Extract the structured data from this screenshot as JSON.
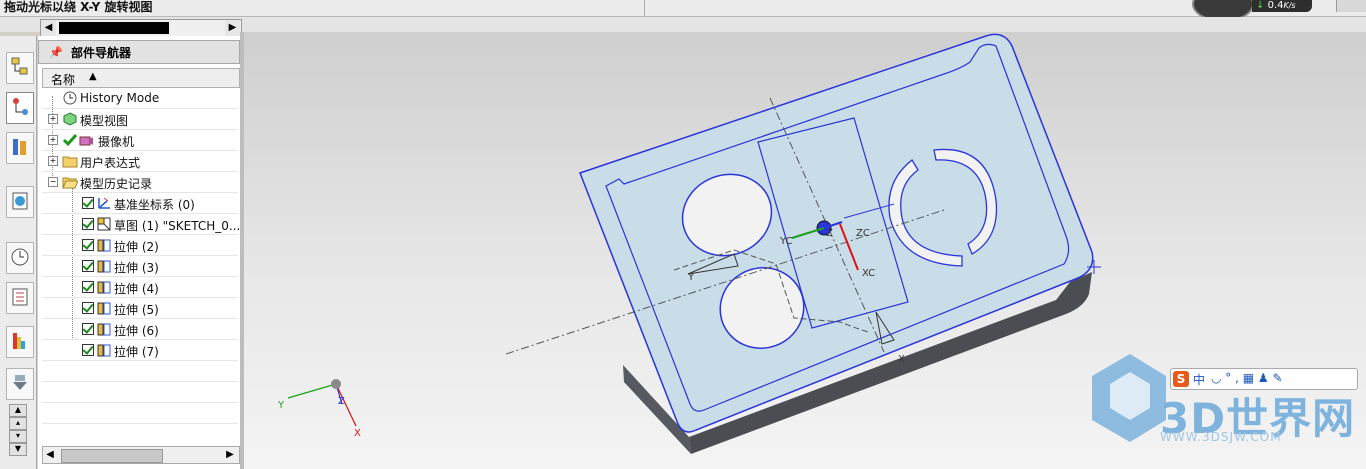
{
  "title_bar": {
    "hint_text": "拖动光标以绕 X-Y 旋转视图"
  },
  "net_speed": {
    "rate": "0.4",
    "unit": "K/s"
  },
  "navigator": {
    "title": "部件导航器",
    "column_header": "名称",
    "items": [
      {
        "label": "History Mode"
      },
      {
        "label": "模型视图"
      },
      {
        "label": "摄像机"
      },
      {
        "label": "用户表达式"
      },
      {
        "label": "模型历史记录"
      },
      {
        "label": "基准坐标系 (0)"
      },
      {
        "label": "草图 (1) \"SKETCH_0..."
      },
      {
        "label": "拉伸 (2)"
      },
      {
        "label": "拉伸 (3)"
      },
      {
        "label": "拉伸 (4)"
      },
      {
        "label": "拉伸 (5)"
      },
      {
        "label": "拉伸 (6)"
      },
      {
        "label": "拉伸 (7)"
      }
    ]
  },
  "viewport": {
    "axis_labels": {
      "x": "X",
      "y": "Y",
      "z": "Z",
      "xc": "XC",
      "yc": "YC",
      "zc": "ZC"
    },
    "triad": {
      "x": "X",
      "y": "Y",
      "z": "Z"
    },
    "watermark": {
      "brand": "3D世界网",
      "url": "WWW.3DSJW.COM"
    },
    "ime_label": "中"
  },
  "colors": {
    "part_face": "#c9dde9",
    "part_edge": "#2a34d8",
    "part_side": "#4a4e53",
    "watermark": "#7db3dd"
  }
}
